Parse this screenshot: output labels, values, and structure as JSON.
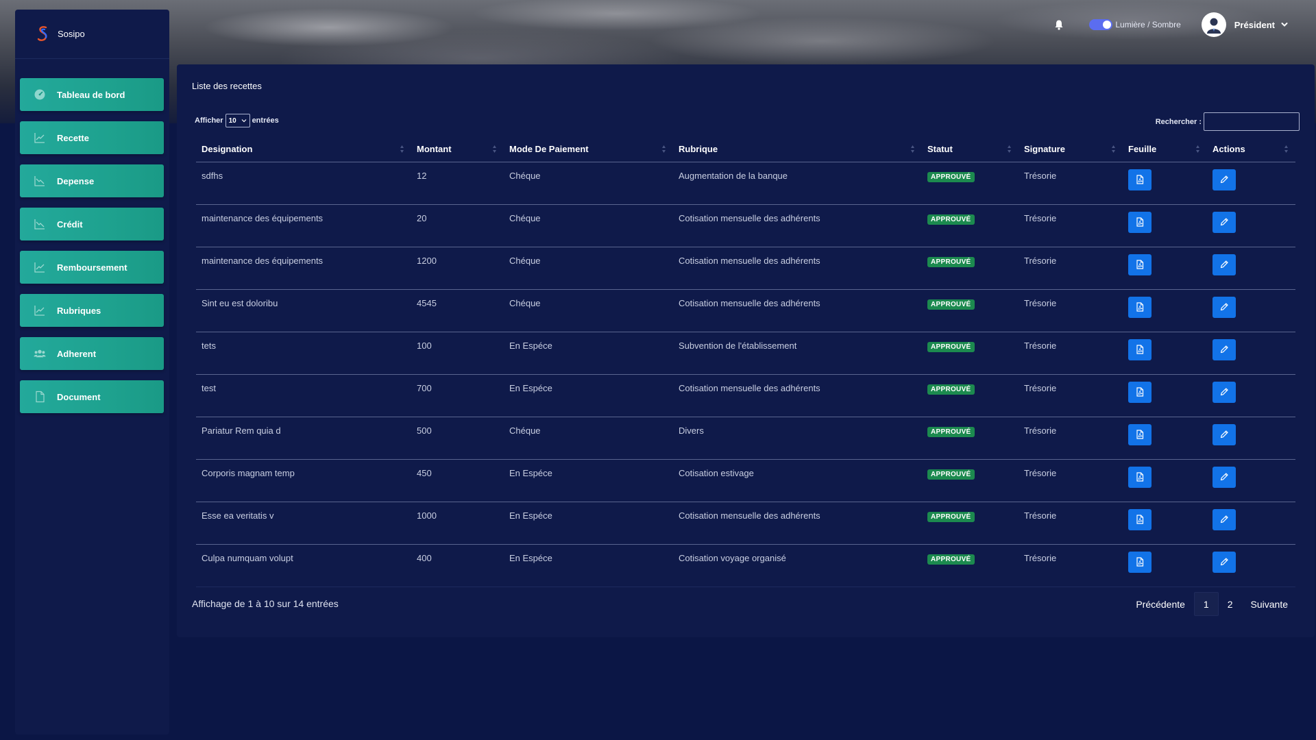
{
  "brand": {
    "name": "Sosipo"
  },
  "sidebar": {
    "items": [
      {
        "label": "Tableau de bord",
        "icon": "dashboard-gauge-icon"
      },
      {
        "label": "Recette",
        "icon": "chart-line-up-icon"
      },
      {
        "label": "Depense",
        "icon": "chart-line-down-icon"
      },
      {
        "label": "Crédit",
        "icon": "chart-line-down-icon"
      },
      {
        "label": "Remboursement",
        "icon": "chart-line-up-icon"
      },
      {
        "label": "Rubriques",
        "icon": "chart-line-up-icon"
      },
      {
        "label": "Adherent",
        "icon": "users-icon"
      },
      {
        "label": "Document",
        "icon": "file-icon"
      }
    ]
  },
  "topbar": {
    "theme_label": "Lumière / Sombre",
    "user_name": "Président"
  },
  "card": {
    "title": "Liste des recettes",
    "length_prefix": "Afficher",
    "length_value": "10",
    "length_suffix": "entrées",
    "search_label": "Rechercher :"
  },
  "table": {
    "columns": [
      "Designation",
      "Montant",
      "Mode De Paiement",
      "Rubrique",
      "Statut",
      "Signature",
      "Feuille",
      "Actions"
    ],
    "rows": [
      {
        "designation": "sdfhs",
        "montant": "12",
        "mode": "Chéque",
        "rubrique": "Augmentation de la banque",
        "statut": "APPROUVÉ",
        "signature": "Trésorie"
      },
      {
        "designation": "maintenance des équipements",
        "montant": "20",
        "mode": "Chéque",
        "rubrique": "Cotisation mensuelle des adhérents",
        "statut": "APPROUVÉ",
        "signature": "Trésorie"
      },
      {
        "designation": "maintenance des équipements",
        "montant": "1200",
        "mode": "Chéque",
        "rubrique": "Cotisation mensuelle des adhérents",
        "statut": "APPROUVÉ",
        "signature": "Trésorie"
      },
      {
        "designation": "Sint eu est doloribu",
        "montant": "4545",
        "mode": "Chéque",
        "rubrique": "Cotisation mensuelle des adhérents",
        "statut": "APPROUVÉ",
        "signature": "Trésorie"
      },
      {
        "designation": "tets",
        "montant": "100",
        "mode": "En Espéce",
        "rubrique": "Subvention de l'établissement",
        "statut": "APPROUVÉ",
        "signature": "Trésorie"
      },
      {
        "designation": "test",
        "montant": "700",
        "mode": "En Espéce",
        "rubrique": "Cotisation mensuelle des adhérents",
        "statut": "APPROUVÉ",
        "signature": "Trésorie"
      },
      {
        "designation": "Pariatur Rem quia d",
        "montant": "500",
        "mode": "Chéque",
        "rubrique": "Divers",
        "statut": "APPROUVÉ",
        "signature": "Trésorie"
      },
      {
        "designation": "Corporis magnam temp",
        "montant": "450",
        "mode": "En Espéce",
        "rubrique": "Cotisation estivage",
        "statut": "APPROUVÉ",
        "signature": "Trésorie"
      },
      {
        "designation": "Esse ea veritatis v",
        "montant": "1000",
        "mode": "En Espéce",
        "rubrique": "Cotisation mensuelle des adhérents",
        "statut": "APPROUVÉ",
        "signature": "Trésorie"
      },
      {
        "designation": "Culpa numquam volupt",
        "montant": "400",
        "mode": "En Espéce",
        "rubrique": "Cotisation voyage organisé",
        "statut": "APPROUVÉ",
        "signature": "Trésorie"
      }
    ]
  },
  "footer": {
    "info": "Affichage de 1 à 10 sur 14 entrées",
    "prev": "Précédente",
    "pages": [
      "1",
      "2"
    ],
    "current_page": "1",
    "next": "Suivante"
  },
  "colors": {
    "background": "#0b1645",
    "panel": "#0f1a4a",
    "nav_accent": "#23a99b",
    "action_button": "#1273e8",
    "status_badge": "#1c8a4f",
    "toggle": "#5b6df0"
  }
}
